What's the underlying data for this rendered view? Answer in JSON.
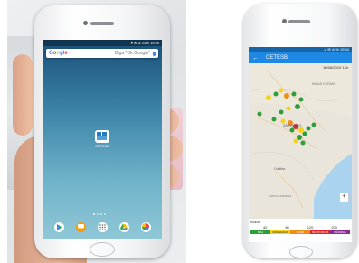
{
  "left_phone": {
    "status_time": "▾ ✉ ⊿ 23% 19:34",
    "search_logo": "Google",
    "search_placeholder": "Diga \"Ok Google\"",
    "app_label": "CETESB",
    "dock_icons": [
      "play-store-icon",
      "messages-icon",
      "apps-icon",
      "drive-icon",
      "photos-icon"
    ]
  },
  "right_phone": {
    "status_time": "⊿ ✉ 44% 19:34",
    "app_title": "CETESB",
    "date_text": "30/08/2019 14h",
    "map_labels": {
      "sao_paulo": "SÃO PAULO",
      "curitiba": "Curitiba",
      "santa_catarina": "SANTA CATARINA",
      "minas": "MINAS GERAIS"
    },
    "legend_title": "Índice",
    "legend_numbers": [
      "40",
      "80",
      "120",
      "200"
    ],
    "legend_categories": [
      "BOA",
      "MODERADA",
      "RUIM",
      "MUITO RUIM",
      "PÉSSIMA"
    ],
    "legend_colors": [
      "#2e9e3a",
      "#f4d21f",
      "#f08c1a",
      "#e0262b",
      "#8a2c8e"
    ],
    "zoom_in": "+"
  }
}
